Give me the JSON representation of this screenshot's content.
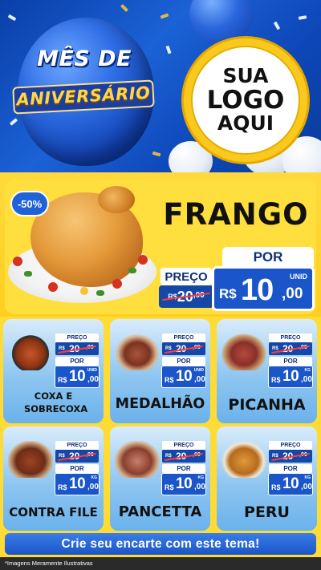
{
  "hero": {
    "title_line1": "MÊS DE",
    "title_line2": "ANIVERSÁRIO",
    "logo_line1": "SUA",
    "logo_line2": "LOGO",
    "logo_line3": "AQUI"
  },
  "featured": {
    "discount": "-50%",
    "name": "FRANGO",
    "price_label": "PREÇO",
    "old_currency": "R$",
    "old_price": "20",
    "old_cents": ",00",
    "por_label": "POR",
    "new_currency": "R$",
    "new_price": "10",
    "new_cents": ",00",
    "unit": "UNID"
  },
  "products": [
    {
      "name": "COXA E SOBRECOXA",
      "price_label": "PREÇO",
      "old_currency": "R$",
      "old_price": "20",
      "old_cents": ",00",
      "por_label": "POR",
      "new_currency": "R$",
      "new_price": "10",
      "new_cents": ",00",
      "unit": "UNID"
    },
    {
      "name": "MEDALHÃO",
      "price_label": "PREÇO",
      "old_currency": "R$",
      "old_price": "20",
      "old_cents": ",00",
      "por_label": "POR",
      "new_currency": "R$",
      "new_price": "10",
      "new_cents": ",00",
      "unit": "UNID"
    },
    {
      "name": "PICANHA",
      "price_label": "PREÇO",
      "old_currency": "R$",
      "old_price": "20",
      "old_cents": ",00",
      "por_label": "POR",
      "new_currency": "R$",
      "new_price": "10",
      "new_cents": ",00",
      "unit": "KG"
    },
    {
      "name": "CONTRA FILE",
      "price_label": "PREÇO",
      "old_currency": "R$",
      "old_price": "20",
      "old_cents": ",00",
      "por_label": "POR",
      "new_currency": "R$",
      "new_price": "10",
      "new_cents": ",00",
      "unit": "KG"
    },
    {
      "name": "PANCETTA",
      "price_label": "PREÇO",
      "old_currency": "R$",
      "old_price": "20",
      "old_cents": ",00",
      "por_label": "POR",
      "new_currency": "R$",
      "new_price": "10",
      "new_cents": ",00",
      "unit": "KG"
    },
    {
      "name": "PERU",
      "price_label": "PREÇO",
      "old_currency": "R$",
      "old_price": "20",
      "old_cents": ",00",
      "por_label": "POR",
      "new_currency": "R$",
      "new_price": "10",
      "new_cents": ",00",
      "unit": "KG"
    }
  ],
  "cta": {
    "label": "Crie seu encarte com este tema!"
  },
  "footer": {
    "disclaimer": "*Imagens Meramente Ilustrativas"
  },
  "colors": {
    "brand_blue": "#1a55c9",
    "brand_yellow": "#ffd93d",
    "strike_red": "#ff3b3b"
  }
}
